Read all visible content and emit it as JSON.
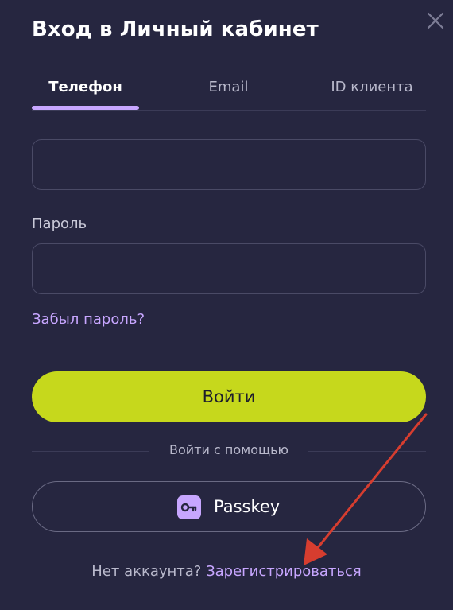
{
  "title": "Вход в Личный кабинет",
  "tabs": [
    {
      "label": "Телефон",
      "active": true
    },
    {
      "label": "Email",
      "active": false
    },
    {
      "label": "ID клиента",
      "active": false
    }
  ],
  "phone_field": {
    "value": "",
    "placeholder": ""
  },
  "password": {
    "label": "Пароль",
    "value": "",
    "placeholder": ""
  },
  "forgot_password": "Забыл пароль?",
  "login_button": "Войти",
  "alt_login": {
    "divider": "Войти с помощью",
    "passkey_label": "Passkey",
    "passkey_icon": "key-icon"
  },
  "footer": {
    "question": "Нет аккаунта?",
    "register_link": "Зарегистрироваться"
  },
  "colors": {
    "background": "#262640",
    "accent_lime": "#c6d81c",
    "accent_purple": "#c7a6ff",
    "annotation_arrow": "#d63d2f"
  }
}
